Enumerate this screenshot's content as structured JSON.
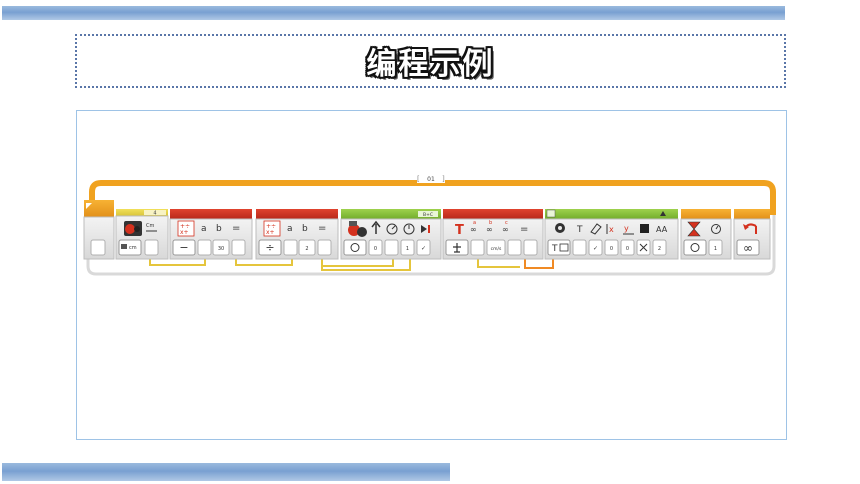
{
  "slide": {
    "title": "编程示例",
    "colors": {
      "band": "#7aa3d4",
      "title_border": "#5a76a8",
      "canvas_border": "#9ec3e6"
    }
  },
  "program": {
    "loop_label": "01",
    "blocks": [
      {
        "id": "sensor",
        "color": "#e8d64a",
        "header_label": "4",
        "icons": [
          "robot-sensor-icon",
          "cm-unit-icon"
        ],
        "unit": "cm"
      },
      {
        "id": "math-subtract",
        "color": "#d7301f",
        "icons": [
          "math-icon"
        ],
        "labels": [
          "a",
          "b",
          "="
        ],
        "op_symbol": "−",
        "values": [
          "30"
        ]
      },
      {
        "id": "math-divide",
        "color": "#d7301f",
        "icons": [
          "math-icon"
        ],
        "labels": [
          "a",
          "b",
          "="
        ],
        "op_symbol": "÷",
        "values": [
          "2"
        ]
      },
      {
        "id": "motor",
        "color": "#8cc63f",
        "header_label": "B+C",
        "icons": [
          "motor-icon",
          "steering-icon",
          "power-icon",
          "rotations-icon",
          "brake-icon"
        ],
        "values": [
          "0",
          "1",
          "✓"
        ]
      },
      {
        "id": "text",
        "color": "#d7301f",
        "icons": [
          "text-icon",
          "merge-icon"
        ],
        "labels": [
          "a",
          "b",
          "c",
          "="
        ],
        "values": [
          "cm/s"
        ]
      },
      {
        "id": "display",
        "color": "#8cc63f",
        "icons": [
          "display-icon",
          "text-mode-icon",
          "eraser-icon",
          "x-icon",
          "y-icon",
          "color-icon",
          "font-icon"
        ],
        "labels": [
          "T",
          "AA"
        ],
        "values": [
          "✓",
          "0",
          "0",
          "2"
        ]
      },
      {
        "id": "wait",
        "color": "#f0a21f",
        "icons": [
          "hourglass-icon",
          "timer-icon"
        ],
        "values": [
          "1"
        ]
      },
      {
        "id": "loop-end",
        "color": "#f0a21f",
        "icons": [
          "loop-back-icon",
          "infinity-icon"
        ],
        "labels": [
          "∞"
        ]
      }
    ]
  }
}
